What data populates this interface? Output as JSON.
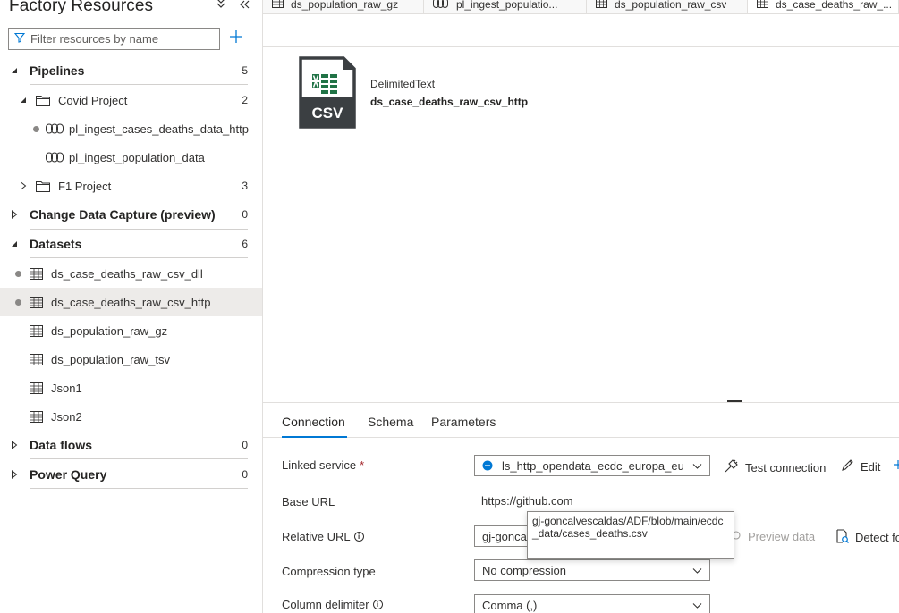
{
  "sidebar": {
    "title": "Factory Resources",
    "filter_placeholder": "Filter resources by name",
    "pipelines": {
      "label": "Pipelines",
      "count": "5",
      "folders": [
        {
          "label": "Covid Project",
          "count": "2",
          "items": [
            "pl_ingest_cases_deaths_data_http",
            "pl_ingest_population_data"
          ]
        },
        {
          "label": "F1 Project",
          "count": "3"
        }
      ]
    },
    "cdc": {
      "label": "Change Data Capture (preview)",
      "count": "0"
    },
    "datasets": {
      "label": "Datasets",
      "count": "6",
      "items": [
        "ds_case_deaths_raw_csv_dll",
        "ds_case_deaths_raw_csv_http",
        "ds_population_raw_gz",
        "ds_population_raw_tsv",
        "Json1",
        "Json2"
      ]
    },
    "dataflows": {
      "label": "Data flows",
      "count": "0"
    },
    "powerquery": {
      "label": "Power Query",
      "count": "0"
    }
  },
  "tabs": [
    {
      "label": "ds_population_raw_gz"
    },
    {
      "label": "pl_ingest_populatio..."
    },
    {
      "label": "ds_population_raw_csv"
    },
    {
      "label": "ds_case_deaths_raw_..."
    }
  ],
  "dataset_card": {
    "icon_text": "CSV",
    "type": "DelimitedText",
    "name": "ds_case_deaths_raw_csv_http"
  },
  "panel": {
    "tabs": [
      "Connection",
      "Schema",
      "Parameters"
    ],
    "linked_service": {
      "label": "Linked service",
      "required_mark": "*",
      "value": "ls_http_opendata_ecdc_europa_eu"
    },
    "actions": {
      "test_connection": "Test connection",
      "edit": "Edit",
      "preview_data": "Preview data",
      "detect_format": "Detect fo"
    },
    "base_url": {
      "label": "Base URL",
      "value": "https://github.com"
    },
    "relative_url": {
      "label": "Relative URL",
      "value": "gj-gonca",
      "tooltip": "gj-goncalvescaldas/ADF/blob/main/ecdc_data/cases_deaths.csv"
    },
    "compression_type": {
      "label": "Compression type",
      "value": "No compression"
    },
    "column_delimiter": {
      "label": "Column delimiter",
      "value": "Comma (,)"
    }
  },
  "colors": {
    "accent": "#0078d4",
    "excel_green": "#217346",
    "selected_row": "#edebe9"
  }
}
